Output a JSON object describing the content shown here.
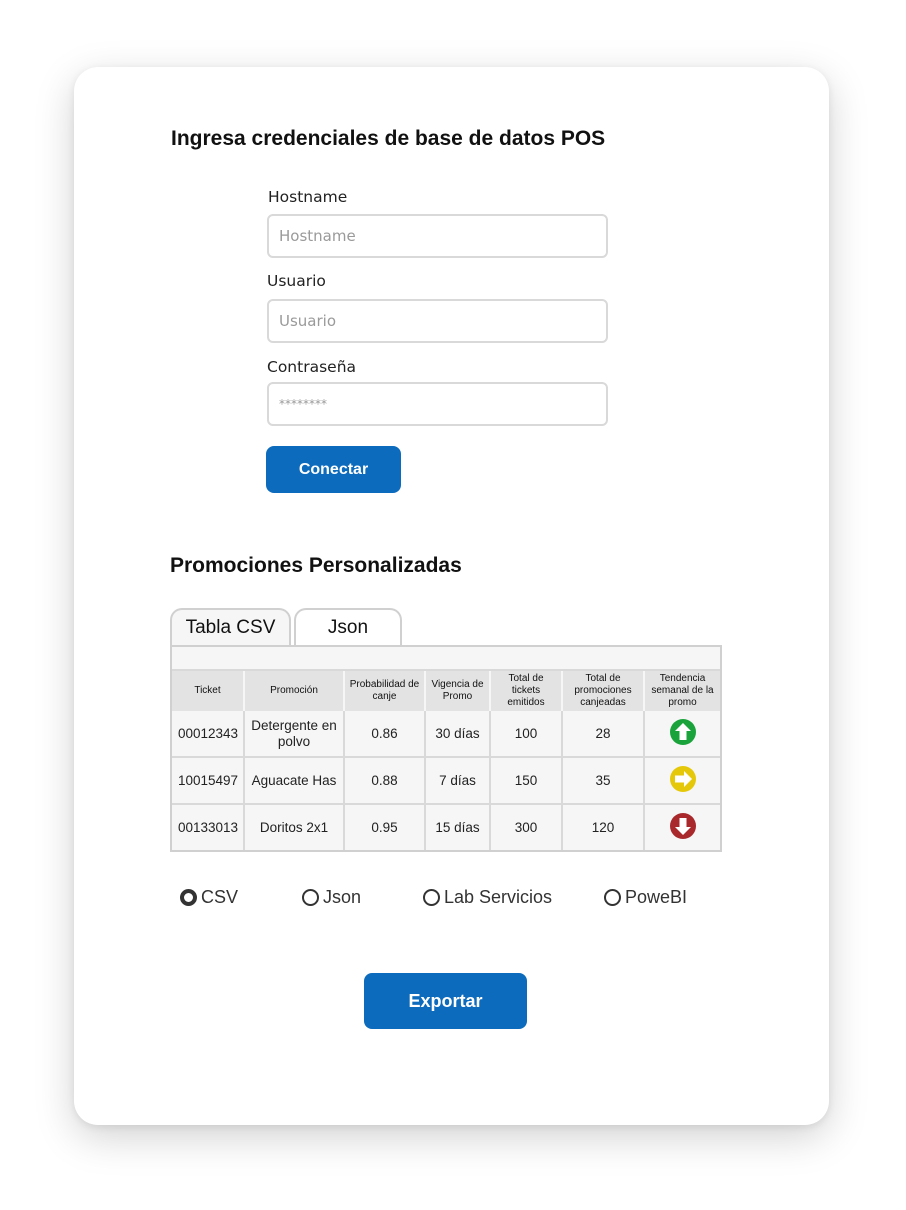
{
  "credentials": {
    "title": "Ingresa credenciales de base de datos POS",
    "hostname_label": "Hostname",
    "hostname_placeholder": "Hostname",
    "usuario_label": "Usuario",
    "usuario_placeholder": "Usuario",
    "password_label": "Contraseña",
    "password_placeholder": "********",
    "connect_label": "Conectar"
  },
  "promos": {
    "title": "Promociones Personalizadas",
    "tabs": [
      {
        "label": "Tabla CSV",
        "active": true
      },
      {
        "label": "Json",
        "active": false
      }
    ],
    "columns": [
      "Ticket",
      "Promoción",
      "Probabilidad de canje",
      "Vigencia de Promo",
      "Total de tickets emitidos",
      "Total de promociones canjeadas",
      "Tendencia semanal de la promo"
    ],
    "rows": [
      {
        "ticket": "00012343",
        "promocion": "Detergente en polvo",
        "probabilidad": "0.86",
        "vigencia": "30 días",
        "tickets": "100",
        "canjeadas": "28",
        "tendencia": "up-arrow-icon"
      },
      {
        "ticket": "10015497",
        "promocion": "Aguacate Has",
        "probabilidad": "0.88",
        "vigencia": "7 días",
        "tickets": "150",
        "canjeadas": "35",
        "tendencia": "right-arrow-icon"
      },
      {
        "ticket": "00133013",
        "promocion": "Doritos 2x1",
        "probabilidad": "0.95",
        "vigencia": "15 días",
        "tickets": "300",
        "canjeadas": "120",
        "tendencia": "down-arrow-icon"
      }
    ]
  },
  "export": {
    "options": [
      {
        "label": "CSV",
        "selected": true
      },
      {
        "label": "Json",
        "selected": false
      },
      {
        "label": "Lab Servicios",
        "selected": false
      },
      {
        "label": "PoweBI",
        "selected": false
      }
    ],
    "export_label": "Exportar"
  },
  "colors": {
    "primary": "#0d6bbd",
    "trend_up": "#1aa33a",
    "trend_flat": "#e6c80a",
    "trend_down": "#a8282c"
  }
}
